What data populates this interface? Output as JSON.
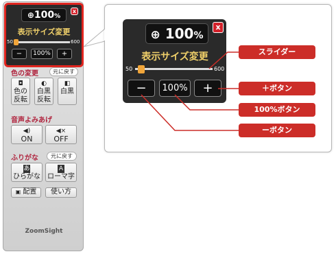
{
  "zoom_panel": {
    "zoom_value": "100",
    "zoom_unit": "%",
    "close_label": "x",
    "title": "表示サイズ変更",
    "slider_min": "50",
    "slider_max": "600",
    "slider_position": 0.0,
    "minus_label": "−",
    "plus_label": "+",
    "reset_label": "100%"
  },
  "toolbar": {
    "color_section": "色の変更",
    "color_reset": "元に戻す",
    "color_buttons": [
      "色の\n反転",
      "白黒\n反転",
      "白黒"
    ],
    "speech_section": "音声よみあげ",
    "speech_on": "ON",
    "speech_off": "OFF",
    "furigana_section": "ふりがな",
    "furigana_reset": "元に戻す",
    "hiragana": "ひらがな",
    "romaji": "ローマ字",
    "hiragana_icon_char": "あ",
    "romaji_icon_char": "A",
    "layout_btn": "配置",
    "help_btn": "使い方",
    "logo": "ZoomSight"
  },
  "callouts": {
    "slider": "スライダー",
    "plus": "＋ボタン",
    "reset": "100%ボタン",
    "minus": "ーボタン"
  },
  "colors": {
    "highlight": "#e0251f",
    "label_bg": "#cc2d28",
    "title": "#f0d06a",
    "thumb": "#f0a53a"
  },
  "icons": [
    "magnifier-icon",
    "close-icon",
    "contrast-icon",
    "speaker-icon",
    "mute-icon",
    "layout-icon"
  ]
}
